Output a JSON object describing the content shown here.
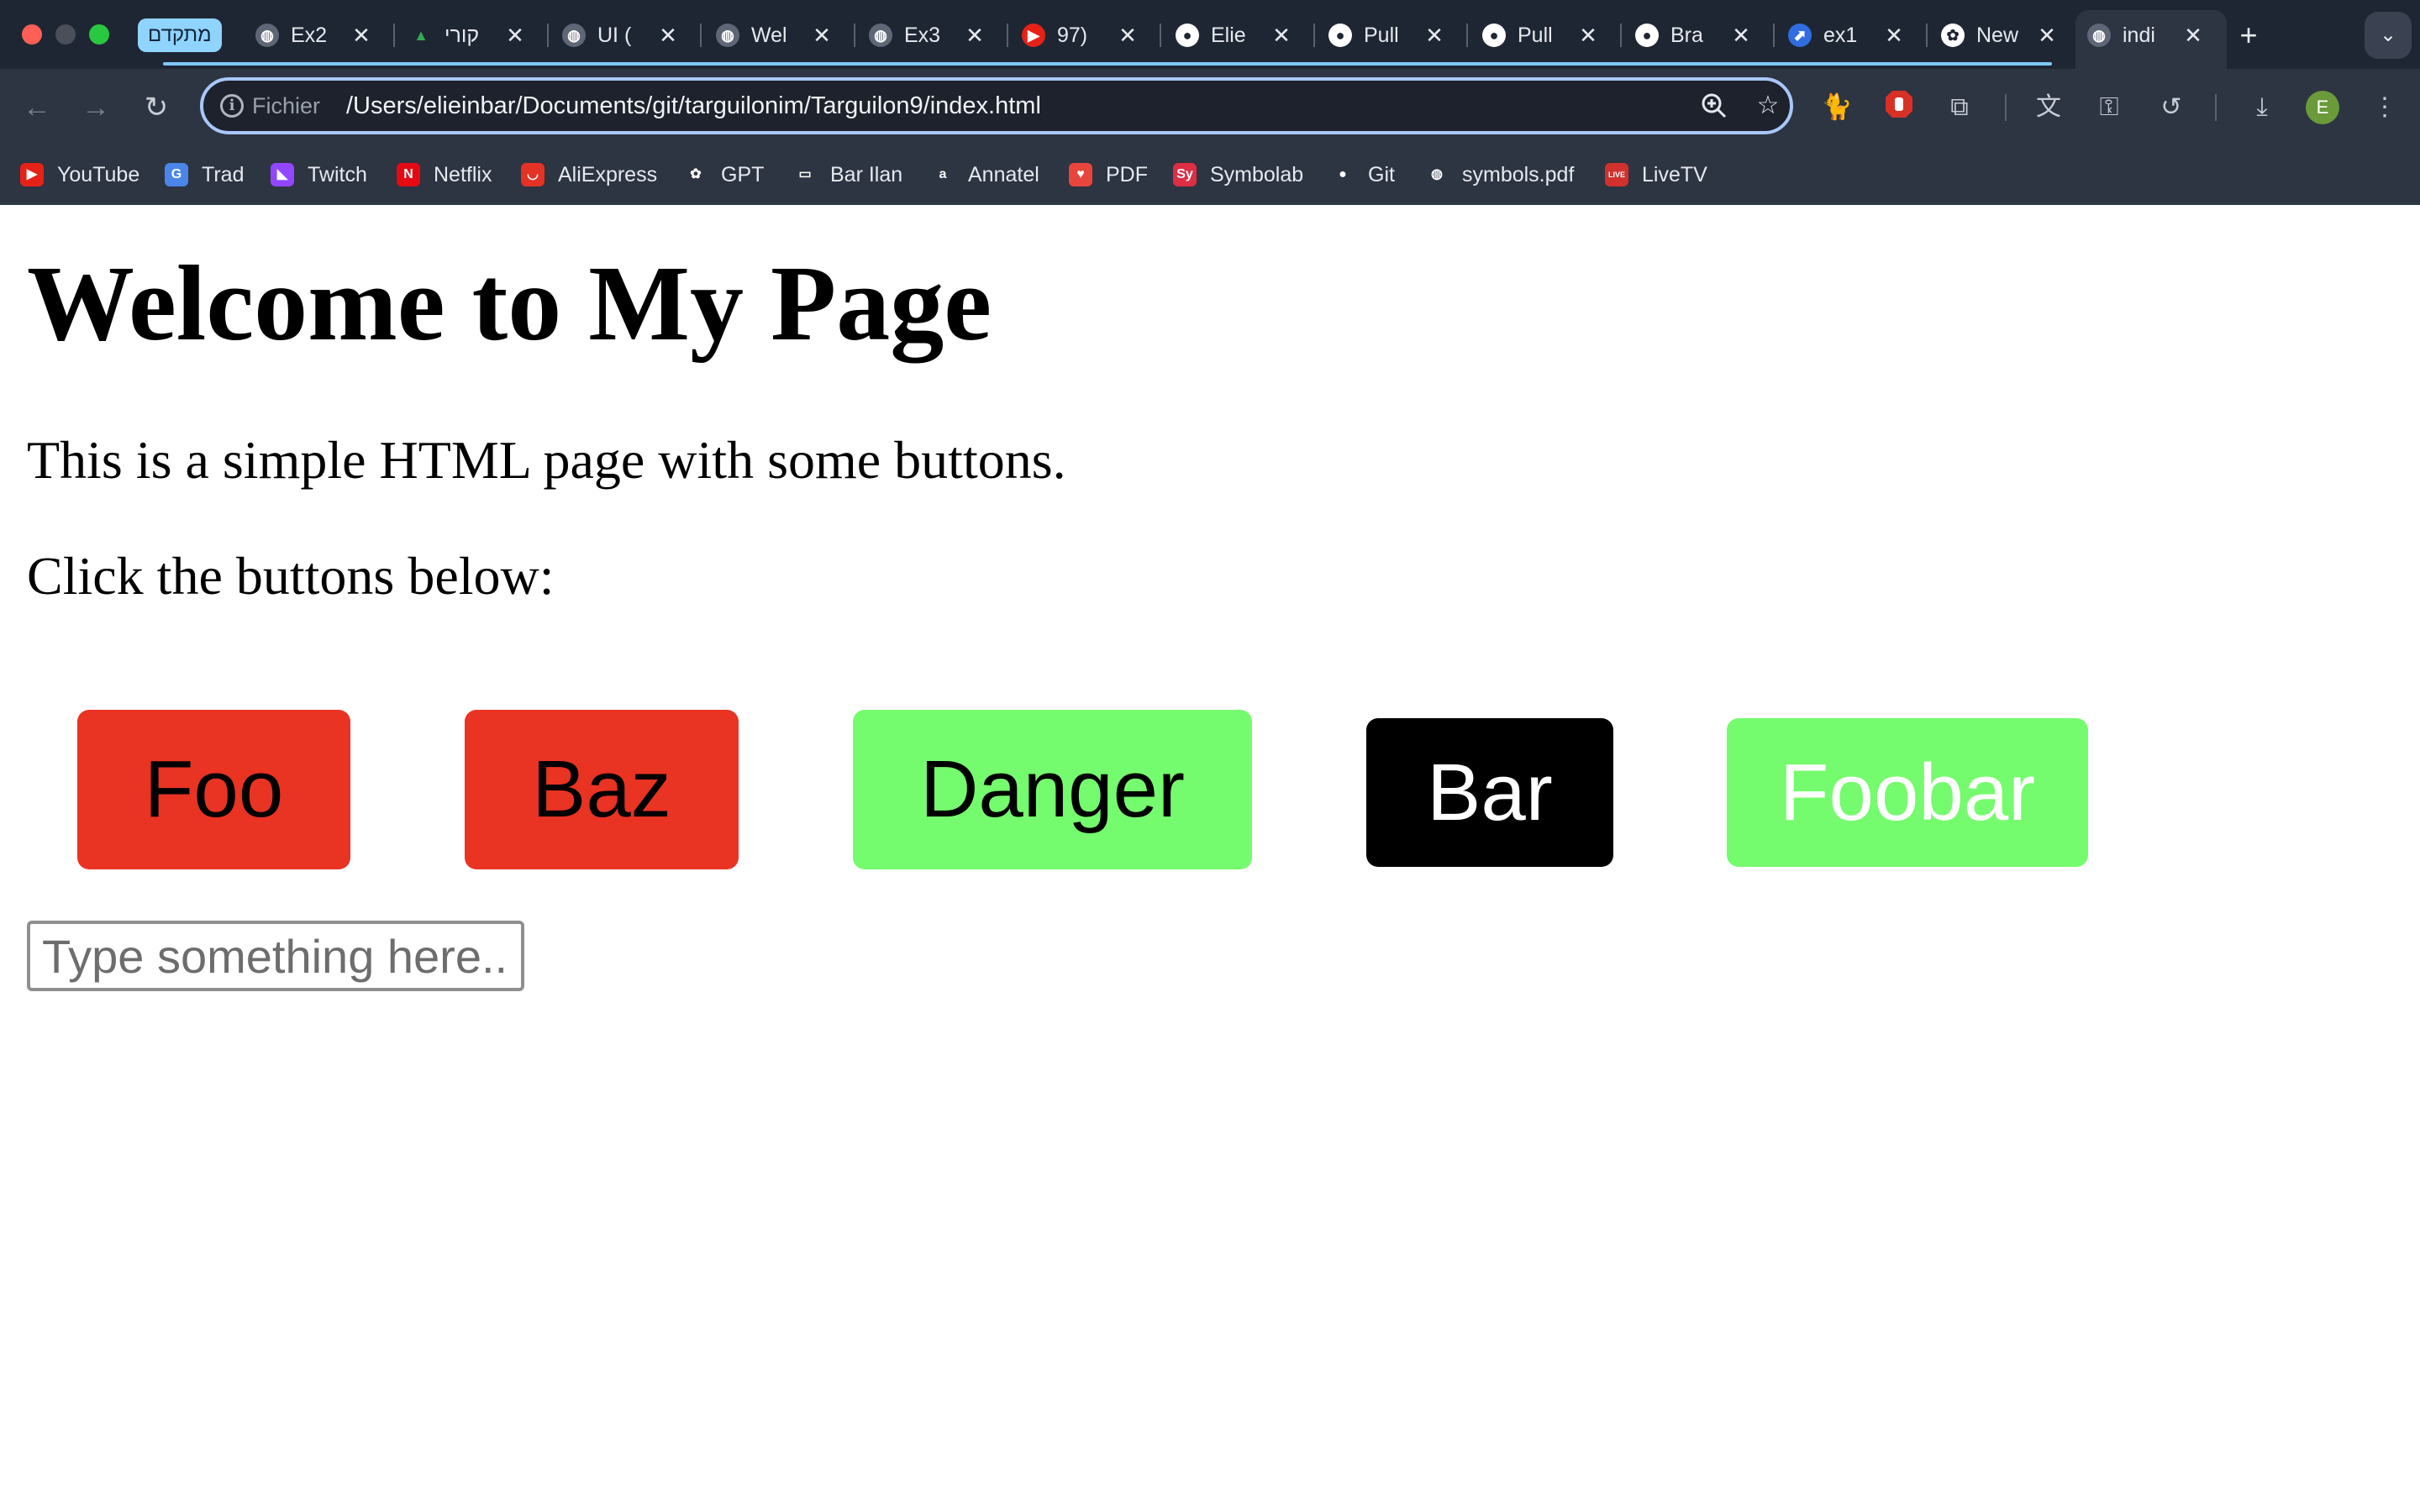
{
  "window": {
    "traffic_lights": [
      "#ff5f57",
      "#4a4f5a",
      "#28c840"
    ]
  },
  "tabs": {
    "pinned_label": "מתקדם",
    "items": [
      {
        "title": "Ex2",
        "icon": "globe-icon"
      },
      {
        "title": "קורי",
        "icon": "drive-icon"
      },
      {
        "title": "UI (",
        "icon": "globe-icon"
      },
      {
        "title": "Wel",
        "icon": "globe-icon"
      },
      {
        "title": "Ex3",
        "icon": "globe-icon"
      },
      {
        "title": "97)",
        "icon": "youtube-icon"
      },
      {
        "title": "Elie",
        "icon": "github-icon"
      },
      {
        "title": "Pull",
        "icon": "github-icon"
      },
      {
        "title": "Pull",
        "icon": "github-icon"
      },
      {
        "title": "Bra",
        "icon": "github-icon"
      },
      {
        "title": "ex1",
        "icon": "jira-icon"
      },
      {
        "title": "New",
        "icon": "openai-icon"
      },
      {
        "title": "indi",
        "icon": "globe-icon",
        "active": true
      }
    ],
    "new_tab_label": "+",
    "close_glyph": "✕"
  },
  "address_bar": {
    "scheme_label": "Fichier",
    "url": "/Users/elieinbar/Documents/git/targuilonim/Targuilon9/index.html"
  },
  "bookmarks": [
    {
      "label": "YouTube",
      "icon": "youtube-icon",
      "color": "#e62117"
    },
    {
      "label": "Trad",
      "icon": "translate-icon",
      "color": "#4a86e8"
    },
    {
      "label": "Twitch",
      "icon": "twitch-icon",
      "color": "#9146ff"
    },
    {
      "label": "Netflix",
      "icon": "netflix-icon",
      "color": "#e50914"
    },
    {
      "label": "AliExpress",
      "icon": "aliexpress-icon",
      "color": "#e43225"
    },
    {
      "label": "GPT",
      "icon": "openai-icon",
      "color": "#2d3442"
    },
    {
      "label": "Bar Ilan",
      "icon": "folder-icon",
      "color": "#2d3442"
    },
    {
      "label": "Annatel",
      "icon": "annatel-icon",
      "color": "#2d3442"
    },
    {
      "label": "PDF",
      "icon": "pdf-icon",
      "color": "#e8453c"
    },
    {
      "label": "Symbolab",
      "icon": "symbolab-icon",
      "color": "#dd2e44"
    },
    {
      "label": "Git",
      "icon": "github-icon",
      "color": "#2d3442"
    },
    {
      "label": "symbols.pdf",
      "icon": "globe-icon",
      "color": "#2d3442"
    },
    {
      "label": "LiveTV",
      "icon": "livetv-icon",
      "color": "#d0312d"
    }
  ],
  "page": {
    "heading": "Welcome to My Page",
    "paragraph_1": "This is a simple HTML page with some buttons.",
    "paragraph_2": "Click the buttons below:",
    "buttons": [
      {
        "label": "Foo",
        "background": "#e93323",
        "color": "#000000"
      },
      {
        "label": "Baz",
        "background": "#e93323",
        "color": "#000000"
      },
      {
        "label": "Danger",
        "background": "#75fb6e",
        "color": "#000000"
      },
      {
        "label": "Bar",
        "background": "#000000",
        "color": "#ffffff"
      },
      {
        "label": "Foobar",
        "background": "#75fb6e",
        "color": "#ffffff"
      }
    ],
    "input_placeholder": "Type something here..."
  }
}
